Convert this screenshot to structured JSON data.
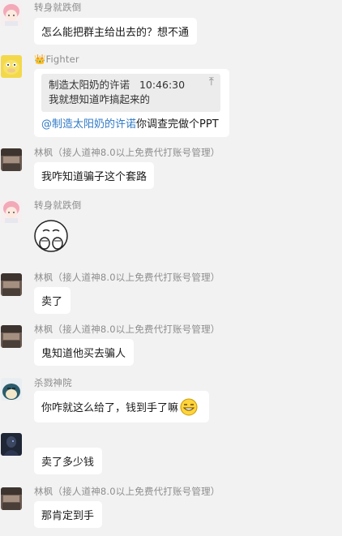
{
  "messages": [
    {
      "name": "转身就跌倒",
      "text": "怎么能把群主给出去的？想不通"
    },
    {
      "name": "Fighter",
      "quote": {
        "author": "制造太阳奶的许诺",
        "time": "10:46:30",
        "text": "我就想知道咋搞起来的"
      },
      "mention": "@制造太阳奶的许诺",
      "text": " 你调查完做个PPT"
    },
    {
      "name": "林枫（接人道神8.0以上免费代打账号管理）",
      "text": "我咋知道骗子这个套路"
    },
    {
      "name": "转身就跌倒",
      "sticker": "covering-mouth-meme"
    },
    {
      "name": "林枫（接人道神8.0以上免费代打账号管理）",
      "text": "卖了"
    },
    {
      "name": "林枫（接人道神8.0以上免费代打账号管理）",
      "text": "鬼知道他买去骗人"
    },
    {
      "name": "杀戮神院",
      "text": "你咋就这么给了，钱到手了嘛",
      "emoji": "grin-emoji"
    },
    {
      "name": "",
      "text": "卖了多少钱"
    },
    {
      "name": "林枫（接人道神8.0以上免费代打账号管理）",
      "text": "那肯定到手"
    }
  ],
  "colors": {
    "background": "#f2f2f2",
    "bubble": "#ffffff",
    "name": "#8d8d8d",
    "mention": "#2f79c6",
    "quote_bg": "#ececec"
  }
}
